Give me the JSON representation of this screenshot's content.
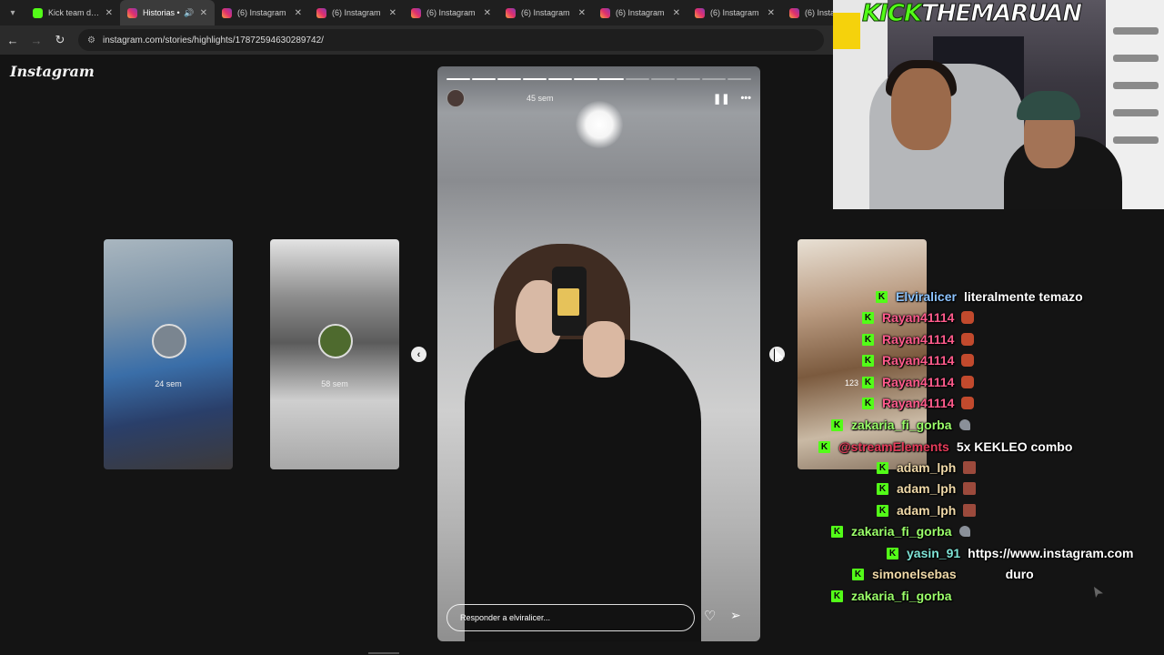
{
  "browser": {
    "tabs": [
      {
        "label": "Kick team dice",
        "favicon": "kick",
        "active": false,
        "audio": false
      },
      {
        "label": "Historias •",
        "favicon": "instagram",
        "active": true,
        "audio": true
      },
      {
        "label": "(6) Instagram",
        "favicon": "instagram",
        "active": false,
        "audio": false
      },
      {
        "label": "(6) Instagram",
        "favicon": "instagram",
        "active": false,
        "audio": false
      },
      {
        "label": "(6) Instagram",
        "favicon": "instagram",
        "active": false,
        "audio": false
      },
      {
        "label": "(6) Instagram",
        "favicon": "instagram",
        "active": false,
        "audio": false
      },
      {
        "label": "(6) Instagram",
        "favicon": "instagram",
        "active": false,
        "audio": false
      },
      {
        "label": "(6) Instagram",
        "favicon": "instagram",
        "active": false,
        "audio": false
      },
      {
        "label": "(6) Instag",
        "favicon": "instagram",
        "active": false,
        "audio": false
      }
    ],
    "close_glyph": "✕",
    "url": "instagram.com/stories/highlights/17872594630289742/"
  },
  "instagram": {
    "logo": "Instagram",
    "side_stories": [
      {
        "time": "24 sem"
      },
      {
        "time": "58 sem"
      }
    ],
    "story": {
      "time": "45 sem",
      "progress_total": 12,
      "progress_done": 7,
      "reply_placeholder": "Responder a elviralicer..."
    }
  },
  "stream": {
    "title_kick": "KICK",
    "title_name": "THEMARUAN",
    "badge_letter": "K"
  },
  "chat": [
    {
      "user": "Elviralicer",
      "color": "blue",
      "text": "literalmente temazo",
      "emote": ""
    },
    {
      "user": "Rayan41114",
      "color": "pink",
      "text": "",
      "emote": "red"
    },
    {
      "user": "Rayan41114",
      "color": "pink",
      "text": "",
      "emote": "red"
    },
    {
      "user": "Rayan41114",
      "color": "pink",
      "text": "",
      "emote": "red"
    },
    {
      "user": "Rayan41114",
      "color": "pink",
      "text": "",
      "emote": "red"
    },
    {
      "user": "Rayan41114",
      "color": "pink",
      "text": "",
      "emote": "red"
    },
    {
      "user": "zakaria_fi_gorba",
      "color": "green",
      "text": "",
      "emote": "grey"
    },
    {
      "user": "@streamElements",
      "color": "red",
      "text": "5x KEKLEO combo",
      "emote": ""
    },
    {
      "user": "adam_lph",
      "color": "beige",
      "text": "",
      "emote": "brick"
    },
    {
      "user": "adam_lph",
      "color": "beige",
      "text": "",
      "emote": "brick"
    },
    {
      "user": "adam_lph",
      "color": "beige",
      "text": "",
      "emote": "brick"
    },
    {
      "user": "zakaria_fi_gorba",
      "color": "green",
      "text": "",
      "emote": "grey"
    },
    {
      "user": "yasin_91",
      "color": "cyan",
      "text": "https://www.instagram.com",
      "emote": ""
    },
    {
      "user": "simonelsebas",
      "color": "beige",
      "text": "duro",
      "emote": ""
    },
    {
      "user": "zakaria_fi_gorba",
      "color": "green",
      "text": "",
      "emote": ""
    }
  ],
  "overlay_number": "123"
}
